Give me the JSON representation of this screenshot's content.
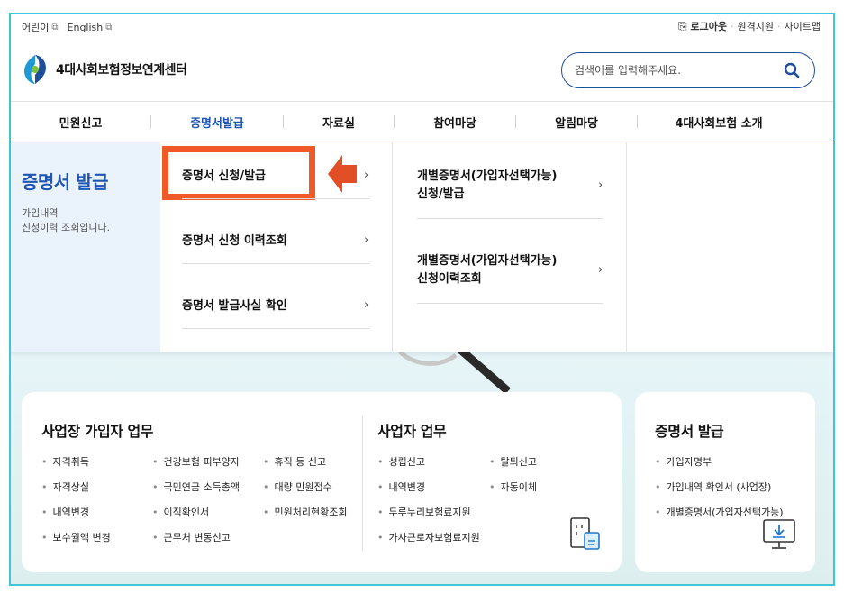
{
  "util": {
    "kids": "어린이",
    "english": "English",
    "logout": "로그아웃",
    "remote": "원격지원",
    "sitemap": "사이트맵",
    "sep": "·"
  },
  "header": {
    "logo_text": "4대사회보험정보연계센터",
    "search_placeholder": "검색어를 입력해주세요."
  },
  "gnb": [
    "민원신고",
    "증명서발급",
    "자료실",
    "참여마당",
    "알림마당",
    "4대사회보험 소개"
  ],
  "gnb_active_index": 1,
  "mega": {
    "title": "증명서 발급",
    "desc_line1": "가입내역",
    "desc_line2": "신청이력 조회입니다.",
    "col1": [
      "증명서 신청/발급",
      "증명서 신청 이력조회",
      "증명서 발급사실 확인"
    ],
    "col2": [
      [
        "개별증명서(가입자선택가능)",
        "신청/발급"
      ],
      [
        "개별증명서(가입자선택가능)",
        "신청이력조회"
      ]
    ],
    "chevron": "›"
  },
  "cards": {
    "workplace": {
      "title": "사업장 가입자 업무",
      "items": [
        "자격취득",
        "자격상실",
        "내역변경",
        "보수월액 변경",
        "건강보험 피부양자",
        "국민연금 소득총액",
        "이직확인서",
        "근무처 변동신고",
        "휴직 등 신고",
        "대량 민원접수",
        "민원처리현황조회"
      ]
    },
    "employer": {
      "title": "사업자 업무",
      "items": [
        "성립신고",
        "내역변경",
        "두루누리보험료지원",
        "가사근로자보험료지원",
        "탈퇴신고",
        "자동이체"
      ]
    },
    "certificate": {
      "title": "증명서 발급",
      "items": [
        "가입자명부",
        "가입내역 확인서 (사업장)",
        "개별증명서(가입자선택가능)"
      ]
    }
  },
  "colors": {
    "accent_blue": "#1f56b3",
    "highlight": "#f05a28",
    "frame": "#3ec6d6"
  }
}
